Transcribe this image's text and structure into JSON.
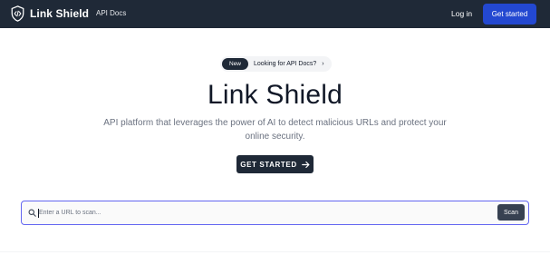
{
  "navbar": {
    "brand_name": "Link Shield",
    "links": [
      {
        "label": "API Docs"
      }
    ],
    "login_label": "Log in",
    "cta_label": "Get started"
  },
  "announcement": {
    "badge": "New",
    "text": "Looking for API Docs?",
    "chevron": "›"
  },
  "hero": {
    "title": "Link Shield",
    "subtitle": "API platform that leverages the power of AI to detect malicious URLs and protect your online security.",
    "cta_label": "GET STARTED"
  },
  "scanner": {
    "placeholder": "Enter a URL to scan...",
    "value": "",
    "button_label": "Scan"
  },
  "colors": {
    "navbar_bg": "#1f2937",
    "primary_blue": "#2348d1",
    "dark_button": "#1f2937",
    "input_focus_border": "#6366f1"
  },
  "icons": {
    "brand": "shield-code-icon",
    "cta_arrow": "arrow-right-icon",
    "search": "search-icon",
    "chevron": "chevron-right-icon"
  }
}
